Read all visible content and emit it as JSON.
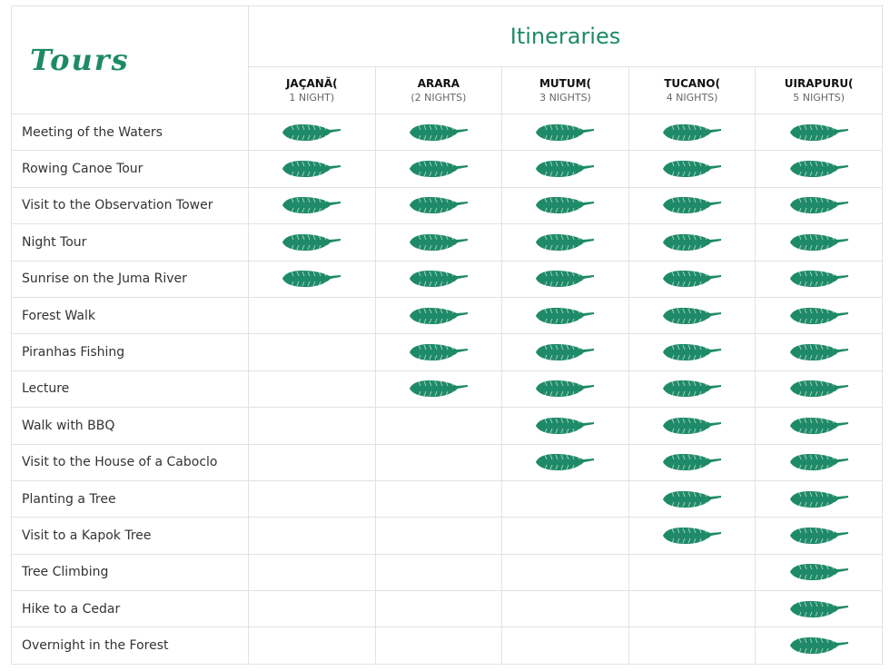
{
  "header": {
    "tours_title": "Tours",
    "itineraries_title": "Itineraries"
  },
  "icon": "leaf-icon",
  "leaf_color": "#1e8a68",
  "columns": [
    {
      "name": "JAÇANÃ(",
      "nights": "1 NIGHT)"
    },
    {
      "name": "ARARA",
      "nights": "(2 NIGHTS)"
    },
    {
      "name": "MUTUM(",
      "nights": "3 NIGHTS)"
    },
    {
      "name": "TUCANO(",
      "nights": "4 NIGHTS)"
    },
    {
      "name": "UIRAPURU(",
      "nights": "5 NIGHTS)"
    }
  ],
  "rows": [
    {
      "tour": "Meeting of the Waters",
      "included": [
        true,
        true,
        true,
        true,
        true
      ]
    },
    {
      "tour": "Rowing Canoe Tour",
      "included": [
        true,
        true,
        true,
        true,
        true
      ]
    },
    {
      "tour": "Visit to the Observation Tower",
      "included": [
        true,
        true,
        true,
        true,
        true
      ]
    },
    {
      "tour": "Night Tour",
      "included": [
        true,
        true,
        true,
        true,
        true
      ]
    },
    {
      "tour": "Sunrise on the Juma River",
      "included": [
        true,
        true,
        true,
        true,
        true
      ]
    },
    {
      "tour": "Forest Walk",
      "included": [
        false,
        true,
        true,
        true,
        true
      ]
    },
    {
      "tour": "Piranhas Fishing",
      "included": [
        false,
        true,
        true,
        true,
        true
      ]
    },
    {
      "tour": "Lecture",
      "included": [
        false,
        true,
        true,
        true,
        true
      ]
    },
    {
      "tour": "Walk with BBQ",
      "included": [
        false,
        false,
        true,
        true,
        true
      ]
    },
    {
      "tour": "Visit to the House of a Caboclo",
      "included": [
        false,
        false,
        true,
        true,
        true
      ]
    },
    {
      "tour": "Planting a Tree",
      "included": [
        false,
        false,
        false,
        true,
        true
      ]
    },
    {
      "tour": "Visit to a Kapok Tree",
      "included": [
        false,
        false,
        false,
        true,
        true
      ]
    },
    {
      "tour": "Tree Climbing",
      "included": [
        false,
        false,
        false,
        false,
        true
      ]
    },
    {
      "tour": "Hike to a Cedar",
      "included": [
        false,
        false,
        false,
        false,
        true
      ]
    },
    {
      "tour": "Overnight in the Forest",
      "included": [
        false,
        false,
        false,
        false,
        true
      ]
    }
  ]
}
